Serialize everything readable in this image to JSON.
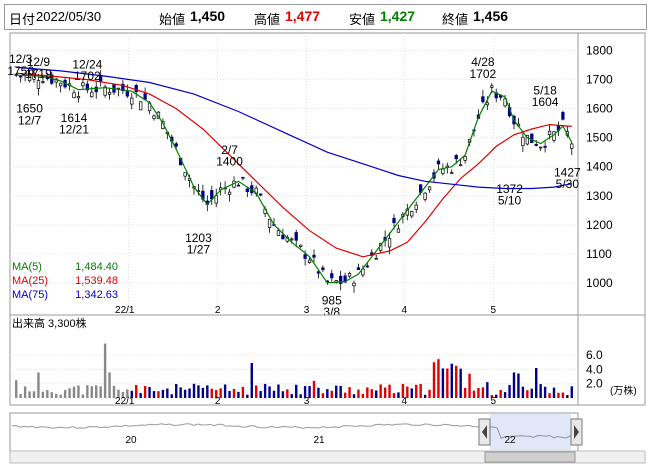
{
  "header": {
    "date_label": "日付",
    "date_value": "2022/05/30",
    "open_label": "始値",
    "open_value": "1,450",
    "high_label": "高値",
    "high_value": "1,477",
    "low_label": "安値",
    "low_value": "1,427",
    "close_label": "終値",
    "close_value": "1,456",
    "colors": {
      "high": "#e00000",
      "low": "#008000",
      "text": "#000000"
    }
  },
  "legend": [
    {
      "label": "MA(5)",
      "value": "1,484.40",
      "color": "#008000"
    },
    {
      "label": "MA(25)",
      "value": "1,539.48",
      "color": "#e00000"
    },
    {
      "label": "MA(75)",
      "value": "1,342.63",
      "color": "#0000cc"
    }
  ],
  "volume_label": "出来高 3,300株",
  "volume_unit": "(万株)",
  "navigator_labels": [
    "20",
    "21",
    "22"
  ],
  "chart_data": [
    {
      "type": "candlestick",
      "x_tick_labels": [
        "22/1",
        "2",
        "3",
        "4",
        "5"
      ],
      "y_ticks": [
        "1800",
        "1700",
        "1600",
        "1500",
        "1400",
        "1300",
        "1200",
        "1100",
        "1000"
      ],
      "ylim": [
        900,
        1850
      ],
      "num_days": 126,
      "month_starts": [
        26,
        46,
        66,
        88,
        108
      ],
      "series": [
        {
          "name": "MA(5)",
          "color": "#008000",
          "points": [
            [
              0,
              1715
            ],
            [
              6,
              1712
            ],
            [
              10,
              1695
            ],
            [
              14,
              1665
            ],
            [
              20,
              1672
            ],
            [
              26,
              1660
            ],
            [
              30,
              1620
            ],
            [
              33,
              1550
            ],
            [
              36,
              1460
            ],
            [
              40,
              1330
            ],
            [
              43,
              1270
            ],
            [
              46,
              1320
            ],
            [
              50,
              1350
            ],
            [
              54,
              1310
            ],
            [
              58,
              1200
            ],
            [
              62,
              1140
            ],
            [
              64,
              1115
            ],
            [
              66,
              1090
            ],
            [
              70,
              1000
            ],
            [
              74,
              1005
            ],
            [
              77,
              1030
            ],
            [
              80,
              1090
            ],
            [
              84,
              1170
            ],
            [
              88,
              1250
            ],
            [
              92,
              1330
            ],
            [
              95,
              1390
            ],
            [
              98,
              1400
            ],
            [
              101,
              1440
            ],
            [
              104,
              1570
            ],
            [
              107,
              1660
            ],
            [
              110,
              1640
            ],
            [
              112,
              1560
            ],
            [
              115,
              1500
            ],
            [
              118,
              1480
            ],
            [
              121,
              1510
            ],
            [
              123,
              1540
            ],
            [
              125,
              1484
            ]
          ]
        },
        {
          "name": "MA(25)",
          "color": "#e00000",
          "points": [
            [
              0,
              1722
            ],
            [
              8,
              1712
            ],
            [
              16,
              1700
            ],
            [
              24,
              1680
            ],
            [
              30,
              1650
            ],
            [
              36,
              1600
            ],
            [
              42,
              1530
            ],
            [
              48,
              1440
            ],
            [
              54,
              1350
            ],
            [
              60,
              1260
            ],
            [
              66,
              1180
            ],
            [
              72,
              1120
            ],
            [
              78,
              1090
            ],
            [
              84,
              1110
            ],
            [
              88,
              1140
            ],
            [
              92,
              1210
            ],
            [
              96,
              1290
            ],
            [
              100,
              1360
            ],
            [
              104,
              1410
            ],
            [
              108,
              1470
            ],
            [
              112,
              1510
            ],
            [
              116,
              1530
            ],
            [
              120,
              1545
            ],
            [
              125,
              1539
            ]
          ]
        },
        {
          "name": "MA(75)",
          "color": "#0000cc",
          "points": [
            [
              0,
              1742
            ],
            [
              10,
              1730
            ],
            [
              20,
              1712
            ],
            [
              30,
              1690
            ],
            [
              40,
              1650
            ],
            [
              50,
              1590
            ],
            [
              60,
              1520
            ],
            [
              70,
              1450
            ],
            [
              80,
              1400
            ],
            [
              86,
              1370
            ],
            [
              92,
              1350
            ],
            [
              98,
              1340
            ],
            [
              104,
              1330
            ],
            [
              110,
              1325
            ],
            [
              116,
              1325
            ],
            [
              121,
              1330
            ],
            [
              125,
              1342
            ]
          ]
        }
      ],
      "annotations": [
        {
          "text": "12/3",
          "day": 1,
          "price": 1770
        },
        {
          "text": "1756",
          "day": 1,
          "price": 1730
        },
        {
          "text": "12/9",
          "day": 5,
          "price": 1760
        },
        {
          "text": "1719",
          "day": 5,
          "price": 1720
        },
        {
          "text": "12/24",
          "day": 16,
          "price": 1752
        },
        {
          "text": "1702",
          "day": 16,
          "price": 1712
        },
        {
          "text": "1650",
          "day": 3,
          "price": 1600
        },
        {
          "text": "12/7",
          "day": 3,
          "price": 1560
        },
        {
          "text": "1614",
          "day": 13,
          "price": 1568
        },
        {
          "text": "12/21",
          "day": 13,
          "price": 1528
        },
        {
          "text": "2/7",
          "day": 48,
          "price": 1458
        },
        {
          "text": "1400",
          "day": 48,
          "price": 1418
        },
        {
          "text": "1203",
          "day": 41,
          "price": 1155
        },
        {
          "text": "1/27",
          "day": 41,
          "price": 1115
        },
        {
          "text": "985",
          "day": 71,
          "price": 940
        },
        {
          "text": "3/8",
          "day": 71,
          "price": 900
        },
        {
          "text": "4/28",
          "day": 105,
          "price": 1760
        },
        {
          "text": "1702",
          "day": 105,
          "price": 1720
        },
        {
          "text": "5/18",
          "day": 119,
          "price": 1662
        },
        {
          "text": "1604",
          "day": 119,
          "price": 1622
        },
        {
          "text": "1372",
          "day": 111,
          "price": 1323
        },
        {
          "text": "5/10",
          "day": 111,
          "price": 1283
        },
        {
          "text": "1427",
          "day": 124,
          "price": 1380
        },
        {
          "text": "5/30",
          "day": 124,
          "price": 1340
        }
      ]
    },
    {
      "type": "bar",
      "title": "出来高 3,300株",
      "y_ticks": [
        "6.0",
        "4.0",
        "2.0"
      ],
      "ylim": [
        0,
        9.5
      ],
      "x_tick_labels": [
        "22/1",
        "2",
        "3",
        "4",
        "5"
      ]
    }
  ]
}
